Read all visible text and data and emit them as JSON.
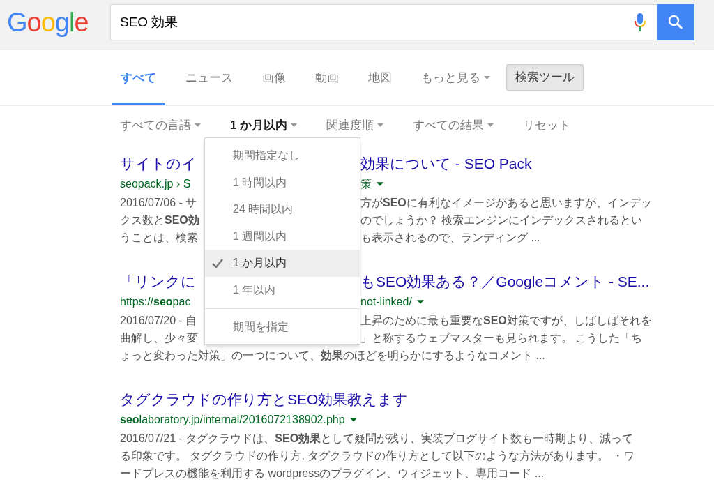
{
  "logo": "Google",
  "search": {
    "value": "SEO 効果"
  },
  "tabs": [
    {
      "label": "すべて",
      "selected": true
    },
    {
      "label": "ニュース",
      "selected": false
    },
    {
      "label": "画像",
      "selected": false
    },
    {
      "label": "動画",
      "selected": false
    },
    {
      "label": "地図",
      "selected": false
    }
  ],
  "more_menu": {
    "label": "もっと見る"
  },
  "search_tools": {
    "label": "検索ツール",
    "pressed": true
  },
  "tools": [
    {
      "label": "すべての言語",
      "active": false,
      "caret": true
    },
    {
      "label": "1 か月以内",
      "active": true,
      "caret": true
    },
    {
      "label": "関連度順",
      "active": false,
      "caret": true
    },
    {
      "label": "すべての結果",
      "active": false,
      "caret": true
    },
    {
      "label": "リセット",
      "active": false,
      "caret": false
    }
  ],
  "time_menu": {
    "items": [
      {
        "label": "期間指定なし",
        "selected": false
      },
      {
        "label": "1 時間以内",
        "selected": false
      },
      {
        "label": "24 時間以内",
        "selected": false
      },
      {
        "label": "1 週間以内",
        "selected": false
      },
      {
        "label": "1 か月以内",
        "selected": true
      },
      {
        "label": "1 年以内",
        "selected": false
      }
    ],
    "custom": "期間を指定"
  },
  "results": [
    {
      "title": [
        "サイトのイ",
        "効果について - SEO Pack"
      ],
      "url": [
        "seopack.jp › S",
        "策"
      ],
      "snippet": [
        [
          "2016/07/06 - サ",
          "方が**SEO**に有利なイメージがあると思いますが、インデッ"
        ],
        [
          "クス数と**SEO効**",
          "のでしょうか？ 検索エンジンにインデックスされるとい"
        ],
        [
          "うことは、検索",
          "も表示されるので、ランディング ..."
        ]
      ]
    },
    {
      "title": [
        "「リンクに",
        "もSEO効果ある？／Googleコメント - SE..."
      ],
      "url": [
        "https://**seo**pac",
        "not-linked/"
      ],
      "snippet": [
        [
          "2016/07/20 - 自",
          "上昇のために最も重要な**SEO**対策ですが、しばしばそれを"
        ],
        [
          "曲解し、少々変",
          "」と称するウェブマスターも見られます。 こうした「ち"
        ],
        [
          "ょっと変わった対策」の一つについて、**効果**のほどを明らかにするようなコメント ..."
        ]
      ]
    },
    {
      "title": [
        "タグクラウドの作り方とSEO効果教えます"
      ],
      "url": [
        "**seo**laboratory.jp/internal/2016072138902.php"
      ],
      "snippet": [
        [
          "2016/07/21 - タグクラウドは、**SEO効果**として疑問が残り、実装ブログサイト数も一時期より、減って"
        ],
        [
          "る印象です。 タグクラウドの作り方. タグクラウドの作り方として以下のような方法があります。 ・ワ"
        ],
        [
          "ードプレスの機能を利用する wordpressのプラグイン、ウィジェット、専用コード ..."
        ]
      ]
    }
  ]
}
